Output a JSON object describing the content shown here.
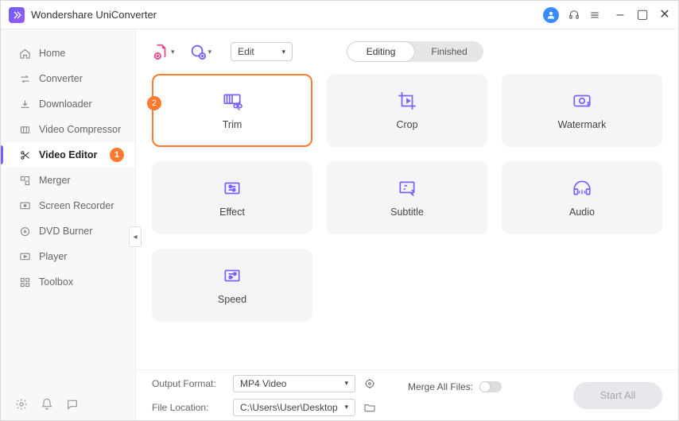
{
  "app_title": "Wondershare UniConverter",
  "titlebar": {
    "minimize": "–",
    "maximize": "▢",
    "close": "✕"
  },
  "nav": {
    "items": [
      {
        "label": "Home"
      },
      {
        "label": "Converter"
      },
      {
        "label": "Downloader"
      },
      {
        "label": "Video Compressor"
      },
      {
        "label": "Video Editor"
      },
      {
        "label": "Merger"
      },
      {
        "label": "Screen Recorder"
      },
      {
        "label": "DVD Burner"
      },
      {
        "label": "Player"
      },
      {
        "label": "Toolbox"
      }
    ],
    "active_badge": "1"
  },
  "toolbar": {
    "edit_label": "Edit",
    "seg_editing": "Editing",
    "seg_finished": "Finished"
  },
  "tiles": [
    {
      "label": "Trim"
    },
    {
      "label": "Crop"
    },
    {
      "label": "Watermark"
    },
    {
      "label": "Effect"
    },
    {
      "label": "Subtitle"
    },
    {
      "label": "Audio"
    },
    {
      "label": "Speed"
    }
  ],
  "tile_badge": "2",
  "bottom": {
    "output_format_label": "Output Format:",
    "output_format_value": "MP4 Video",
    "file_location_label": "File Location:",
    "file_location_value": "C:\\Users\\User\\Desktop",
    "merge_label": "Merge All Files:",
    "start_label": "Start All"
  }
}
